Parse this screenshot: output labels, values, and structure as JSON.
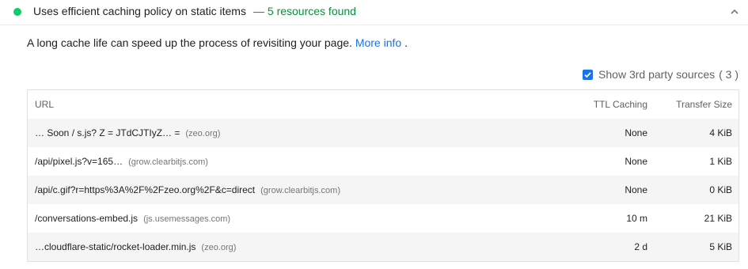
{
  "audit": {
    "title": "Uses efficient caching policy on static items",
    "summary": "— 5 resources found",
    "status_color": "#0cce6b"
  },
  "description": {
    "text": "A long cache life can speed up the process of revisiting your page.",
    "link": "More info",
    "suffix": "."
  },
  "third_party": {
    "label": "Show 3rd party sources",
    "count": "( 3 )",
    "checked": true
  },
  "table": {
    "headers": {
      "url": "URL",
      "ttl": "TTL Caching",
      "size": "Transfer Size"
    },
    "rows": [
      {
        "url": "… Soon / s.js? Z = JTdCJTIyZ… =",
        "origin": "(zeo.org)",
        "ttl": "None",
        "size": "4 KiB"
      },
      {
        "url": "/api/pixel.js?v=165…",
        "origin": "(grow.clearbitjs.com)",
        "ttl": "None",
        "size": "1 KiB"
      },
      {
        "url": "/api/c.gif?r=https%3A%2F%2Fzeo.org%2F&c=direct",
        "origin": "(grow.clearbitjs.com)",
        "ttl": "None",
        "size": "0 KiB"
      },
      {
        "url": "/conversations-embed.js",
        "origin": "(js.usemessages.com)",
        "ttl": "10 m",
        "size": "21 KiB"
      },
      {
        "url": "…cloudflare-static/rocket-loader.min.js",
        "origin": "(zeo.org)",
        "ttl": "2 d",
        "size": "5 KiB"
      }
    ]
  }
}
